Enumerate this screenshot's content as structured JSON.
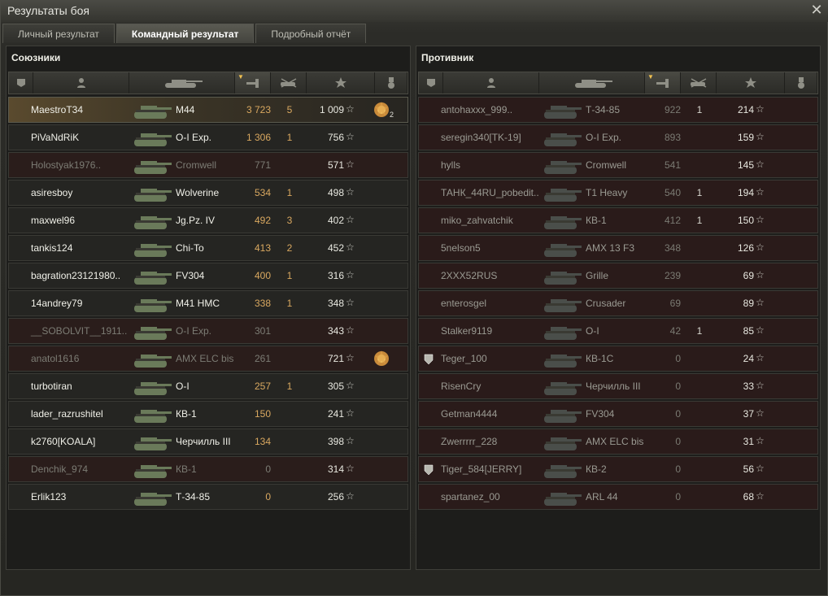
{
  "window": {
    "title": "Результаты боя"
  },
  "tabs": [
    {
      "label": "Личный результат",
      "active": false
    },
    {
      "label": "Командный результат",
      "active": true
    },
    {
      "label": "Подробный отчёт",
      "active": false
    }
  ],
  "colors": {
    "accent": "#d9a860",
    "background": "#1d1d1b",
    "row_first": "#5a4a2e",
    "row_dead": "#2a1d1b"
  },
  "star_glyph": "☆",
  "allies": {
    "title": "Союзники",
    "rows": [
      {
        "player": "MaestroT34",
        "tank": "M44",
        "damage": "3 723",
        "kills": "5",
        "xp": "1 009",
        "medal": true,
        "medal_count": "2",
        "first": true
      },
      {
        "player": "PiVaNdRiK",
        "tank": "O-I Exp.",
        "damage": "1 306",
        "kills": "1",
        "xp": "756"
      },
      {
        "player": "Holostyak1976..",
        "tank": "Cromwell",
        "damage": "771",
        "kills": "",
        "xp": "571",
        "dead": true
      },
      {
        "player": "asiresboy",
        "tank": "Wolverine",
        "damage": "534",
        "kills": "1",
        "xp": "498"
      },
      {
        "player": "maxwel96",
        "tank": "Jg.Pz. IV",
        "damage": "492",
        "kills": "3",
        "xp": "402"
      },
      {
        "player": "tankis124",
        "tank": "Chi-To",
        "damage": "413",
        "kills": "2",
        "xp": "452"
      },
      {
        "player": "bagration23121980..",
        "tank": "FV304",
        "damage": "400",
        "kills": "1",
        "xp": "316"
      },
      {
        "player": "14andrey79",
        "tank": "M41 HMC",
        "damage": "338",
        "kills": "1",
        "xp": "348"
      },
      {
        "player": "__SOBOLVIT__1911..",
        "tank": "O-I Exp.",
        "damage": "301",
        "kills": "",
        "xp": "343",
        "dead": true
      },
      {
        "player": "anatol1616",
        "tank": "AMX ELC bis",
        "damage": "261",
        "kills": "",
        "xp": "721",
        "dead": true,
        "medal": true
      },
      {
        "player": "turbotiran",
        "tank": "O-I",
        "damage": "257",
        "kills": "1",
        "xp": "305"
      },
      {
        "player": "lader_razrushitel",
        "tank": "КВ-1",
        "damage": "150",
        "kills": "",
        "xp": "241"
      },
      {
        "player": "k2760[KOALA]",
        "tank": "Черчилль III",
        "damage": "134",
        "kills": "",
        "xp": "398"
      },
      {
        "player": "Denchik_974",
        "tank": "КВ-1",
        "damage": "0",
        "kills": "",
        "xp": "314",
        "dead": true
      },
      {
        "player": "Erlik123",
        "tank": "Т-34-85",
        "damage": "0",
        "kills": "",
        "xp": "256"
      }
    ]
  },
  "enemies": {
    "title": "Противник",
    "rows": [
      {
        "player": "antohaxxx_999..",
        "tank": "Т-34-85",
        "damage": "922",
        "kills": "1",
        "xp": "214"
      },
      {
        "player": "seregin340[TK-19]",
        "tank": "O-I Exp.",
        "damage": "893",
        "kills": "",
        "xp": "159"
      },
      {
        "player": "hylls",
        "tank": "Cromwell",
        "damage": "541",
        "kills": "",
        "xp": "145"
      },
      {
        "player": "ТАНК_44RU_pobedit..",
        "tank": "T1 Heavy",
        "damage": "540",
        "kills": "1",
        "xp": "194"
      },
      {
        "player": "miko_zahvatchik",
        "tank": "КВ-1",
        "damage": "412",
        "kills": "1",
        "xp": "150"
      },
      {
        "player": "5nelson5",
        "tank": "AMX 13 F3",
        "damage": "348",
        "kills": "",
        "xp": "126"
      },
      {
        "player": "2XXX52RUS",
        "tank": "Grille",
        "damage": "239",
        "kills": "",
        "xp": "69"
      },
      {
        "player": "enterosgel",
        "tank": "Crusader",
        "damage": "69",
        "kills": "",
        "xp": "89"
      },
      {
        "player": "Stalker9119",
        "tank": "O-I",
        "damage": "42",
        "kills": "1",
        "xp": "85"
      },
      {
        "player": "Teger_100",
        "tank": "КВ-1С",
        "damage": "0",
        "kills": "",
        "xp": "24",
        "clan": true
      },
      {
        "player": "RisenCry",
        "tank": "Черчилль III",
        "damage": "0",
        "kills": "",
        "xp": "33"
      },
      {
        "player": "Getman4444",
        "tank": "FV304",
        "damage": "0",
        "kills": "",
        "xp": "37"
      },
      {
        "player": "Zwerrrrr_228",
        "tank": "AMX ELC bis",
        "damage": "0",
        "kills": "",
        "xp": "31"
      },
      {
        "player": "Tiger_584[JERRY]",
        "tank": "КВ-2",
        "damage": "0",
        "kills": "",
        "xp": "56",
        "clan": true
      },
      {
        "player": "spartanez_00",
        "tank": "ARL 44",
        "damage": "0",
        "kills": "",
        "xp": "68"
      }
    ]
  },
  "header_icons": [
    "squad-icon",
    "player-icon",
    "tank-icon",
    "damage-icon",
    "kills-icon",
    "xp-star-icon",
    "medal-icon"
  ]
}
